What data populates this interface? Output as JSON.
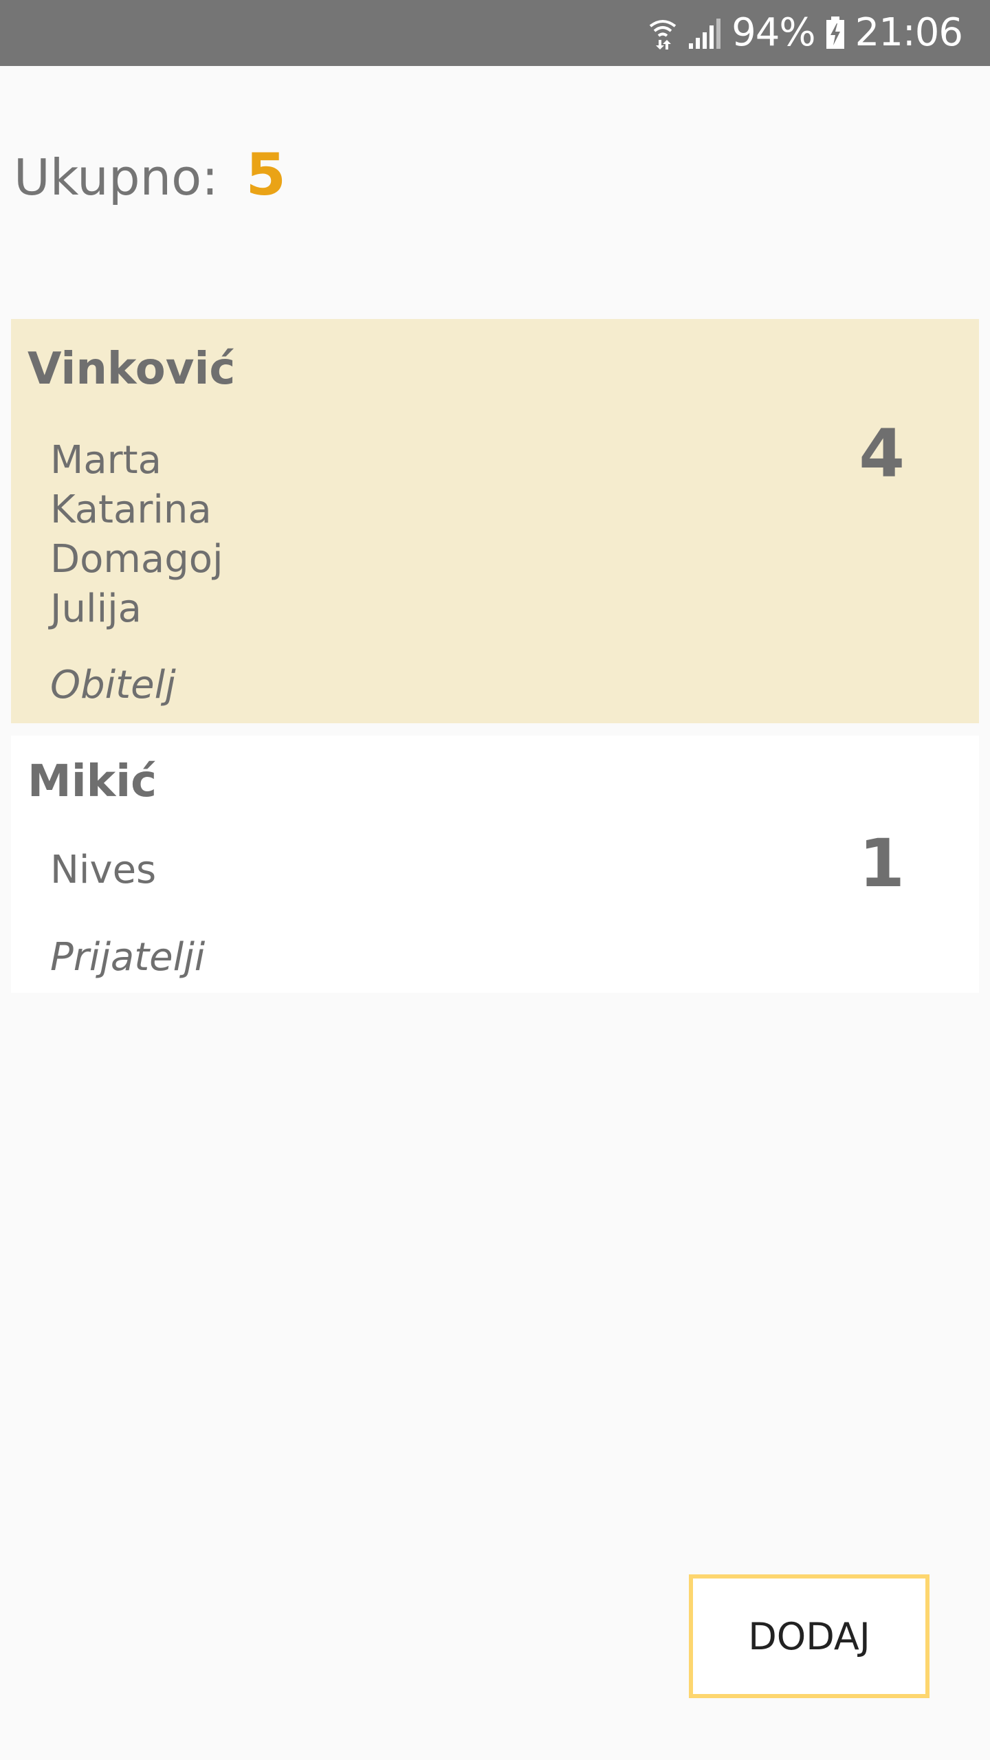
{
  "status_bar": {
    "battery": "94%",
    "time": "21:06",
    "icons": [
      "wifi-icon",
      "signal-icon",
      "battery-charging-icon"
    ]
  },
  "total": {
    "label": "Ukupno:",
    "value": "5"
  },
  "groups": [
    {
      "name": "Vinković",
      "members": [
        "Marta",
        "Katarina",
        "Domagoj",
        "Julija"
      ],
      "category": "Obitelj",
      "count": "4",
      "background": "#f5ecce"
    },
    {
      "name": "Mikić",
      "members": [
        "Nives"
      ],
      "category": "Prijatelji",
      "count": "1",
      "background": "#ffffff"
    }
  ],
  "add_button": {
    "label": "DODAJ"
  },
  "colors": {
    "status_bar": "#757575",
    "accent": "#eaa316",
    "button_border": "#fdd66f",
    "text": "#6f6f6f",
    "background": "#fafafa"
  }
}
